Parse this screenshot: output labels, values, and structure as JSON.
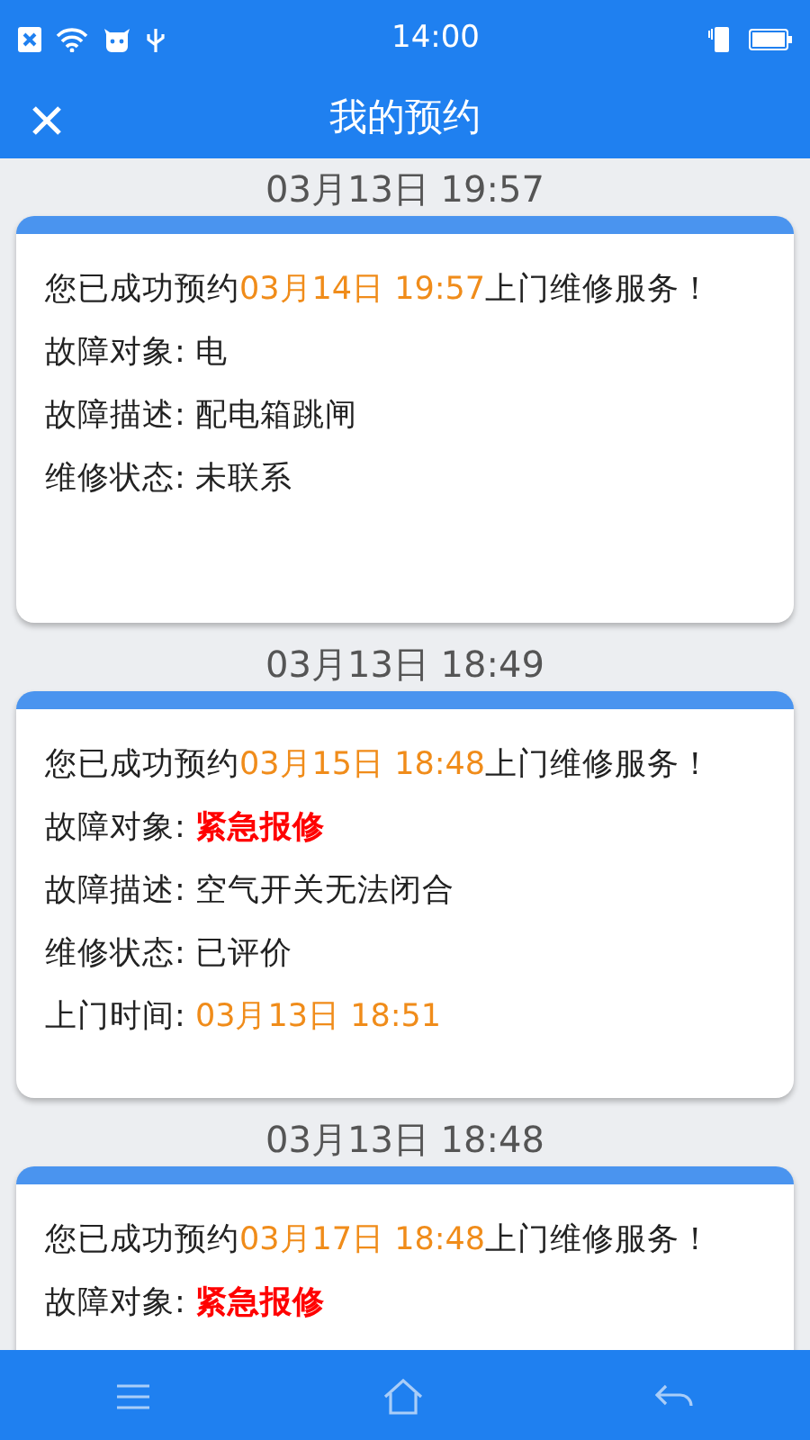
{
  "status_bar": {
    "time": "14:00"
  },
  "header": {
    "title": "我的预约"
  },
  "bookings": [
    {
      "date": "03月13日 19:57",
      "notice": {
        "prefix": "您已成功预约",
        "time": "03月14日 19:57",
        "suffix": "上门维修服务！"
      },
      "fields": [
        {
          "label": "故障对象:",
          "value": "电",
          "kind": "plain"
        },
        {
          "label": "故障描述:",
          "value": "配电箱跳闸",
          "kind": "plain"
        },
        {
          "label": "维修状态:",
          "value": "未联系",
          "kind": "plain"
        }
      ]
    },
    {
      "date": "03月13日 18:49",
      "notice": {
        "prefix": "您已成功预约",
        "time": "03月15日 18:48",
        "suffix": "上门维修服务！"
      },
      "fields": [
        {
          "label": "故障对象:",
          "value": "紧急报修",
          "kind": "urgent"
        },
        {
          "label": "故障描述:",
          "value": "空气开关无法闭合",
          "kind": "plain"
        },
        {
          "label": "维修状态:",
          "value": "已评价",
          "kind": "plain"
        },
        {
          "label": "上门时间:",
          "value": "03月13日 18:51",
          "kind": "time"
        }
      ]
    },
    {
      "date": "03月13日 18:48",
      "notice": {
        "prefix": "您已成功预约",
        "time": "03月17日 18:48",
        "suffix": "上门维修服务！"
      },
      "fields": [
        {
          "label": "故障对象:",
          "value": "紧急报修",
          "kind": "urgent"
        }
      ]
    }
  ]
}
